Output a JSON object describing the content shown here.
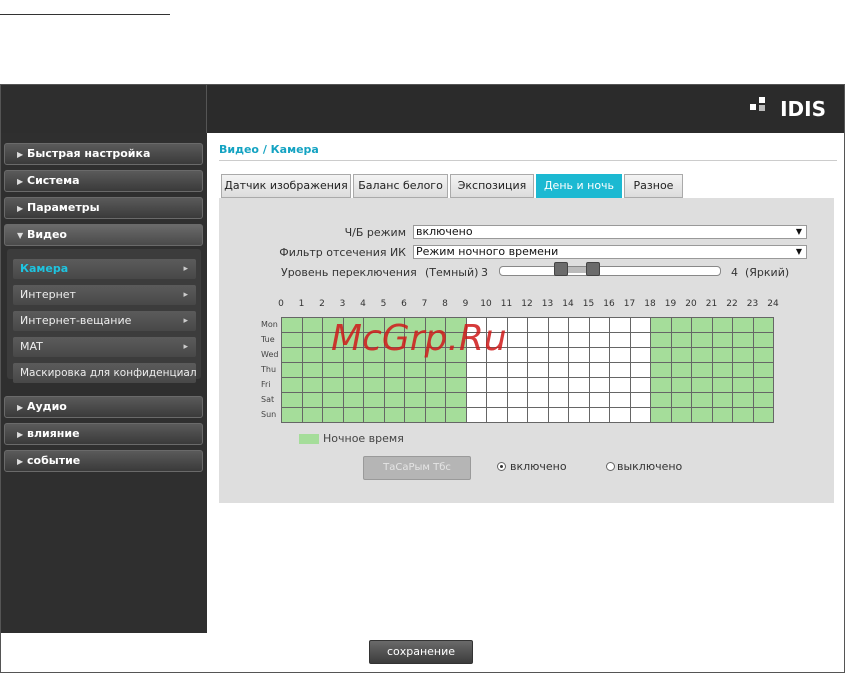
{
  "app": {
    "logo": "IDIS"
  },
  "sidebar": {
    "items": [
      {
        "label": "Быстрая настройка"
      },
      {
        "label": "Система"
      },
      {
        "label": "Параметры"
      },
      {
        "label": "Видео"
      },
      {
        "label": "Аудио"
      },
      {
        "label": "влияние"
      },
      {
        "label": "событие"
      }
    ],
    "submenu": [
      {
        "label": "Камера"
      },
      {
        "label": "Интернет"
      },
      {
        "label": "Интернет-вещание"
      },
      {
        "label": "MAT"
      },
      {
        "label": "Маскировка для конфиденциальн"
      }
    ]
  },
  "breadcrumb": "Видео / Камера",
  "tabs": [
    {
      "label": "Датчик изображения"
    },
    {
      "label": "Баланс белого"
    },
    {
      "label": "Экспозиция"
    },
    {
      "label": "День и ночь"
    },
    {
      "label": "Разное"
    }
  ],
  "form": {
    "bw_mode_label": "Ч/Б режим",
    "bw_mode_value": "включено",
    "ir_filter_label": "Фильтр отсечения ИК",
    "ir_filter_value": "Режим ночного времени",
    "switch_level_label": "Уровень переключения",
    "switch_level_dark": "(Темный)",
    "switch_level_min": "3",
    "switch_level_max": "4",
    "switch_level_bright": "(Яркий)",
    "slider_low": 3,
    "slider_high": 4
  },
  "schedule": {
    "hours": [
      "0",
      "1",
      "2",
      "3",
      "4",
      "5",
      "6",
      "7",
      "8",
      "9",
      "10",
      "11",
      "12",
      "13",
      "14",
      "15",
      "16",
      "17",
      "18",
      "19",
      "20",
      "21",
      "22",
      "23",
      "24"
    ],
    "days": [
      "Mon",
      "Tue",
      "Wed",
      "Thu",
      "Fri",
      "Sat",
      "Sun"
    ],
    "night_hours": [
      0,
      1,
      2,
      3,
      4,
      5,
      6,
      7,
      8,
      18,
      19,
      20,
      21,
      22,
      23
    ],
    "night_color": "#a5dd9a",
    "legend": "Ночное время"
  },
  "apply_button": "ТаСаРым Тбс",
  "radio": {
    "on_label": "включено",
    "off_label": "выключено",
    "selected": "on"
  },
  "save_button": "сохранение",
  "watermark": "McGrp.Ru",
  "colors": {
    "accent": "#1cb9d2",
    "breadcrumb": "#14a3c2"
  }
}
